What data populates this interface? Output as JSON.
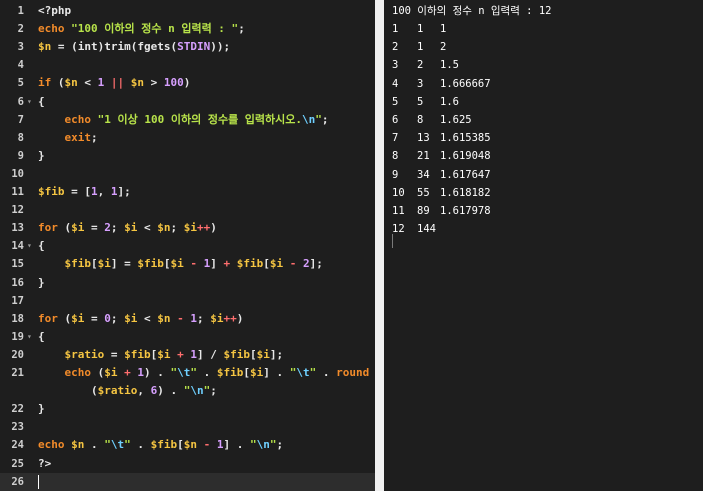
{
  "editor": {
    "lines": [
      {
        "n": "1",
        "fold": false,
        "tokens": [
          [
            "plain",
            "<?php"
          ]
        ]
      },
      {
        "n": "2",
        "fold": false,
        "tokens": [
          [
            "kw",
            "echo"
          ],
          [
            "plain",
            " "
          ],
          [
            "str",
            "\"100 이하의 정수 n 입력력 : \""
          ],
          [
            "plain",
            ";"
          ]
        ]
      },
      {
        "n": "3",
        "fold": false,
        "tokens": [
          [
            "var",
            "$n"
          ],
          [
            "plain",
            " = ("
          ],
          [
            "plain",
            "int"
          ],
          [
            "plain",
            ")"
          ],
          [
            "fn",
            "trim"
          ],
          [
            "plain",
            "("
          ],
          [
            "fn",
            "fgets"
          ],
          [
            "plain",
            "("
          ],
          [
            "num",
            "STDIN"
          ],
          [
            "plain",
            "));"
          ]
        ]
      },
      {
        "n": "4",
        "fold": false,
        "tokens": []
      },
      {
        "n": "5",
        "fold": false,
        "tokens": [
          [
            "kw",
            "if"
          ],
          [
            "plain",
            " ("
          ],
          [
            "var",
            "$n"
          ],
          [
            "plain",
            " < "
          ],
          [
            "num",
            "1"
          ],
          [
            "plain",
            " "
          ],
          [
            "op",
            "||"
          ],
          [
            "plain",
            " "
          ],
          [
            "var",
            "$n"
          ],
          [
            "plain",
            " > "
          ],
          [
            "num",
            "100"
          ],
          [
            "plain",
            ")"
          ]
        ]
      },
      {
        "n": "6",
        "fold": true,
        "tokens": [
          [
            "plain",
            "{"
          ]
        ]
      },
      {
        "n": "7",
        "fold": false,
        "tokens": [
          [
            "plain",
            "    "
          ],
          [
            "kw",
            "echo"
          ],
          [
            "plain",
            " "
          ],
          [
            "str",
            "\"1 이상 100 이하의 정수를 입력하시오."
          ],
          [
            "esc",
            "\\n"
          ],
          [
            "str",
            "\""
          ],
          [
            "plain",
            ";"
          ]
        ]
      },
      {
        "n": "8",
        "fold": false,
        "tokens": [
          [
            "plain",
            "    "
          ],
          [
            "kw",
            "exit"
          ],
          [
            "plain",
            ";"
          ]
        ]
      },
      {
        "n": "9",
        "fold": false,
        "tokens": [
          [
            "plain",
            "}"
          ]
        ]
      },
      {
        "n": "10",
        "fold": false,
        "tokens": []
      },
      {
        "n": "11",
        "fold": false,
        "tokens": [
          [
            "var",
            "$fib"
          ],
          [
            "plain",
            " = ["
          ],
          [
            "num",
            "1"
          ],
          [
            "plain",
            ", "
          ],
          [
            "num",
            "1"
          ],
          [
            "plain",
            "];"
          ]
        ]
      },
      {
        "n": "12",
        "fold": false,
        "tokens": []
      },
      {
        "n": "13",
        "fold": false,
        "tokens": [
          [
            "kw",
            "for"
          ],
          [
            "plain",
            " ("
          ],
          [
            "var",
            "$i"
          ],
          [
            "plain",
            " = "
          ],
          [
            "num",
            "2"
          ],
          [
            "plain",
            "; "
          ],
          [
            "var",
            "$i"
          ],
          [
            "plain",
            " < "
          ],
          [
            "var",
            "$n"
          ],
          [
            "plain",
            "; "
          ],
          [
            "var",
            "$i"
          ],
          [
            "op",
            "++"
          ],
          [
            "plain",
            ")"
          ]
        ]
      },
      {
        "n": "14",
        "fold": true,
        "tokens": [
          [
            "plain",
            "{"
          ]
        ]
      },
      {
        "n": "15",
        "fold": false,
        "tokens": [
          [
            "plain",
            "    "
          ],
          [
            "var",
            "$fib"
          ],
          [
            "plain",
            "["
          ],
          [
            "var",
            "$i"
          ],
          [
            "plain",
            "] = "
          ],
          [
            "var",
            "$fib"
          ],
          [
            "plain",
            "["
          ],
          [
            "var",
            "$i"
          ],
          [
            "plain",
            " "
          ],
          [
            "op",
            "-"
          ],
          [
            "plain",
            " "
          ],
          [
            "num",
            "1"
          ],
          [
            "plain",
            "] "
          ],
          [
            "op",
            "+"
          ],
          [
            "plain",
            " "
          ],
          [
            "var",
            "$fib"
          ],
          [
            "plain",
            "["
          ],
          [
            "var",
            "$i"
          ],
          [
            "plain",
            " "
          ],
          [
            "op",
            "-"
          ],
          [
            "plain",
            " "
          ],
          [
            "num",
            "2"
          ],
          [
            "plain",
            "];"
          ]
        ]
      },
      {
        "n": "16",
        "fold": false,
        "tokens": [
          [
            "plain",
            "}"
          ]
        ]
      },
      {
        "n": "17",
        "fold": false,
        "tokens": []
      },
      {
        "n": "18",
        "fold": false,
        "tokens": [
          [
            "kw",
            "for"
          ],
          [
            "plain",
            " ("
          ],
          [
            "var",
            "$i"
          ],
          [
            "plain",
            " = "
          ],
          [
            "num",
            "0"
          ],
          [
            "plain",
            "; "
          ],
          [
            "var",
            "$i"
          ],
          [
            "plain",
            " < "
          ],
          [
            "var",
            "$n"
          ],
          [
            "plain",
            " "
          ],
          [
            "op",
            "-"
          ],
          [
            "plain",
            " "
          ],
          [
            "num",
            "1"
          ],
          [
            "plain",
            "; "
          ],
          [
            "var",
            "$i"
          ],
          [
            "op",
            "++"
          ],
          [
            "plain",
            ")"
          ]
        ]
      },
      {
        "n": "19",
        "fold": true,
        "tokens": [
          [
            "plain",
            "{"
          ]
        ]
      },
      {
        "n": "20",
        "fold": false,
        "tokens": [
          [
            "plain",
            "    "
          ],
          [
            "var",
            "$ratio"
          ],
          [
            "plain",
            " = "
          ],
          [
            "var",
            "$fib"
          ],
          [
            "plain",
            "["
          ],
          [
            "var",
            "$i"
          ],
          [
            "plain",
            " "
          ],
          [
            "op",
            "+"
          ],
          [
            "plain",
            " "
          ],
          [
            "num",
            "1"
          ],
          [
            "plain",
            "] / "
          ],
          [
            "var",
            "$fib"
          ],
          [
            "plain",
            "["
          ],
          [
            "var",
            "$i"
          ],
          [
            "plain",
            "];"
          ]
        ]
      },
      {
        "n": "21",
        "fold": false,
        "tokens": [
          [
            "plain",
            "    "
          ],
          [
            "kw",
            "echo"
          ],
          [
            "plain",
            " ("
          ],
          [
            "var",
            "$i"
          ],
          [
            "plain",
            " "
          ],
          [
            "op",
            "+"
          ],
          [
            "plain",
            " "
          ],
          [
            "num",
            "1"
          ],
          [
            "plain",
            ") . "
          ],
          [
            "str",
            "\""
          ],
          [
            "esc",
            "\\t"
          ],
          [
            "str",
            "\""
          ],
          [
            "plain",
            " . "
          ],
          [
            "var",
            "$fib"
          ],
          [
            "plain",
            "["
          ],
          [
            "var",
            "$i"
          ],
          [
            "plain",
            "] . "
          ],
          [
            "str",
            "\""
          ],
          [
            "esc",
            "\\t"
          ],
          [
            "str",
            "\""
          ],
          [
            "plain",
            " . "
          ],
          [
            "kw",
            "round"
          ]
        ]
      },
      {
        "n": "",
        "fold": false,
        "tokens": [
          [
            "plain",
            "        ("
          ],
          [
            "var",
            "$ratio"
          ],
          [
            "plain",
            ", "
          ],
          [
            "num",
            "6"
          ],
          [
            "plain",
            ") . "
          ],
          [
            "str",
            "\""
          ],
          [
            "esc",
            "\\n"
          ],
          [
            "str",
            "\""
          ],
          [
            "plain",
            ";"
          ]
        ]
      },
      {
        "n": "22",
        "fold": false,
        "tokens": [
          [
            "plain",
            "}"
          ]
        ]
      },
      {
        "n": "23",
        "fold": false,
        "tokens": []
      },
      {
        "n": "24",
        "fold": false,
        "tokens": [
          [
            "kw",
            "echo"
          ],
          [
            "plain",
            " "
          ],
          [
            "var",
            "$n"
          ],
          [
            "plain",
            " . "
          ],
          [
            "str",
            "\""
          ],
          [
            "esc",
            "\\t"
          ],
          [
            "str",
            "\""
          ],
          [
            "plain",
            " . "
          ],
          [
            "var",
            "$fib"
          ],
          [
            "plain",
            "["
          ],
          [
            "var",
            "$n"
          ],
          [
            "plain",
            " "
          ],
          [
            "op",
            "-"
          ],
          [
            "plain",
            " "
          ],
          [
            "num",
            "1"
          ],
          [
            "plain",
            "] . "
          ],
          [
            "str",
            "\""
          ],
          [
            "esc",
            "\\n"
          ],
          [
            "str",
            "\""
          ],
          [
            "plain",
            ";"
          ]
        ]
      },
      {
        "n": "25",
        "fold": false,
        "tokens": [
          [
            "plain",
            "?>"
          ]
        ]
      },
      {
        "n": "26",
        "fold": false,
        "active": true,
        "tokens": []
      }
    ]
  },
  "console": {
    "prompt": "100 이하의 정수 n 입력력 : 12",
    "rows": [
      [
        "1",
        "1",
        "1"
      ],
      [
        "2",
        "1",
        "2"
      ],
      [
        "3",
        "2",
        "1.5"
      ],
      [
        "4",
        "3",
        "1.666667"
      ],
      [
        "5",
        "5",
        "1.6"
      ],
      [
        "6",
        "8",
        "1.625"
      ],
      [
        "7",
        "13",
        "1.615385"
      ],
      [
        "8",
        "21",
        "1.619048"
      ],
      [
        "9",
        "34",
        "1.617647"
      ],
      [
        "10",
        "55",
        "1.618182"
      ],
      [
        "11",
        "89",
        "1.617978"
      ],
      [
        "12",
        "144",
        ""
      ]
    ]
  }
}
